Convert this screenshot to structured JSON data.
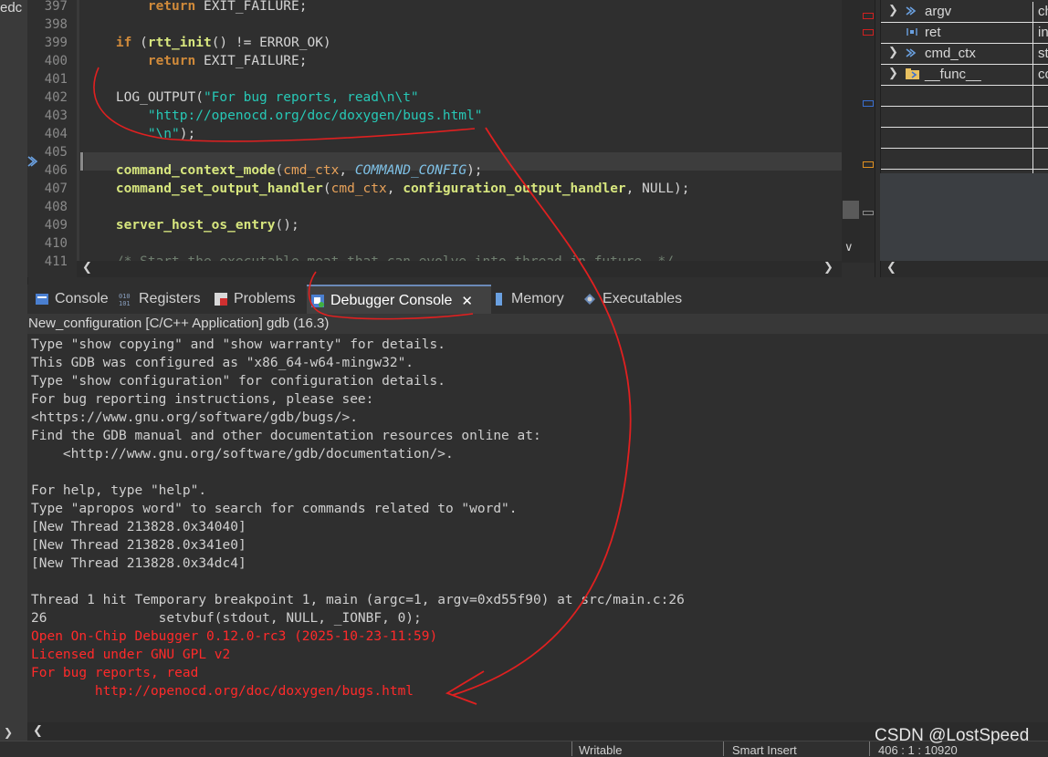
{
  "left_strip_text": "edc",
  "editor": {
    "lines": [
      {
        "no": "397",
        "html": "    <span class='kw2'>return</span> EXIT_FAILURE;"
      },
      {
        "no": "398",
        "html": ""
      },
      {
        "no": "399",
        "html": "<span class='kw2'>if</span> (<span class='fn'>rtt_init</span>() != ERROR_OK)"
      },
      {
        "no": "400",
        "html": "    <span class='kw2'>return</span> EXIT_FAILURE;"
      },
      {
        "no": "401",
        "html": ""
      },
      {
        "no": "402",
        "html": "LOG_OUTPUT(<span class='str'>\"For bug reports, read\\n\\t\"</span>"
      },
      {
        "no": "403",
        "html": "    <span class='str'>\"http://openocd.org/doc/doxygen/bugs.html\"</span>"
      },
      {
        "no": "404",
        "html": "    <span class='str'>\"\\n\"</span>);"
      },
      {
        "no": "405",
        "html": ""
      },
      {
        "no": "406",
        "html": "<span class='fn'>command_context_mode</span>(<span class='var'>cmd_ctx</span>, <span class='cst'>COMMAND_CONFIG</span>);"
      },
      {
        "no": "407",
        "html": "<span class='fn'>command_set_output_handler</span>(<span class='var'>cmd_ctx</span>, <span class='fn'>configuration_output_handler</span>, NULL);"
      },
      {
        "no": "408",
        "html": ""
      },
      {
        "no": "409",
        "html": "<span class='fn'>server_host_os_entry</span>();"
      },
      {
        "no": "410",
        "html": ""
      },
      {
        "no": "411",
        "html": "<span class='cmt'>/* Start the executable meat that can evolve into thread in future. */</span>"
      }
    ]
  },
  "variables": [
    {
      "name": "argv",
      "value": "ch",
      "expandable": true,
      "icon": "variable-icon"
    },
    {
      "name": "ret",
      "value": "in",
      "expandable": false,
      "icon": "local-variable-icon"
    },
    {
      "name": "cmd_ctx",
      "value": "st",
      "expandable": true,
      "icon": "variable-icon"
    },
    {
      "name": "__func__",
      "value": "co",
      "expandable": true,
      "icon": "folder-variable-icon"
    }
  ],
  "tabs": [
    {
      "label": "Console",
      "icon": "console-icon"
    },
    {
      "label": "Registers",
      "icon": "registers-icon"
    },
    {
      "label": "Problems",
      "icon": "problems-icon"
    },
    {
      "label": "Debugger Console",
      "icon": "debugger-console-icon",
      "active": true
    },
    {
      "label": "Memory",
      "icon": "memory-icon"
    },
    {
      "label": "Executables",
      "icon": "executables-icon"
    }
  ],
  "console_header": "New_configuration [C/C++ Application] gdb (16.3)",
  "console": [
    {
      "t": "Type \"show copying\" and \"show warranty\" for details."
    },
    {
      "t": "This GDB was configured as \"x86_64-w64-mingw32\"."
    },
    {
      "t": "Type \"show configuration\" for configuration details."
    },
    {
      "t": "For bug reporting instructions, please see:"
    },
    {
      "t": "<https://www.gnu.org/software/gdb/bugs/>."
    },
    {
      "t": "Find the GDB manual and other documentation resources online at:"
    },
    {
      "t": "    <http://www.gnu.org/software/gdb/documentation/>."
    },
    {
      "t": ""
    },
    {
      "t": "For help, type \"help\"."
    },
    {
      "t": "Type \"apropos word\" to search for commands related to \"word\"."
    },
    {
      "t": "[New Thread 213828.0x34040]"
    },
    {
      "t": "[New Thread 213828.0x341e0]"
    },
    {
      "t": "[New Thread 213828.0x34dc4]"
    },
    {
      "t": ""
    },
    {
      "t": "Thread 1 hit Temporary breakpoint 1, main (argc=1, argv=0xd55f90) at src/main.c:26"
    },
    {
      "t": "26              setvbuf(stdout, NULL, _IONBF, 0);"
    },
    {
      "t": "Open On-Chip Debugger 0.12.0-rc3 (2025-10-23-11:59)",
      "red": true
    },
    {
      "t": "Licensed under GNU GPL v2",
      "red": true
    },
    {
      "t": "For bug reports, read",
      "red": true
    },
    {
      "t": "        http://openocd.org/doc/doxygen/bugs.html",
      "red": true
    }
  ],
  "statusbar": {
    "writable": "Writable",
    "insert_mode": "Smart Insert",
    "position": "406 : 1 : 10920"
  },
  "watermark": "CSDN @LostSpeed",
  "colors": {
    "annotation": "#e02020",
    "accent": "#6b8ab8"
  }
}
